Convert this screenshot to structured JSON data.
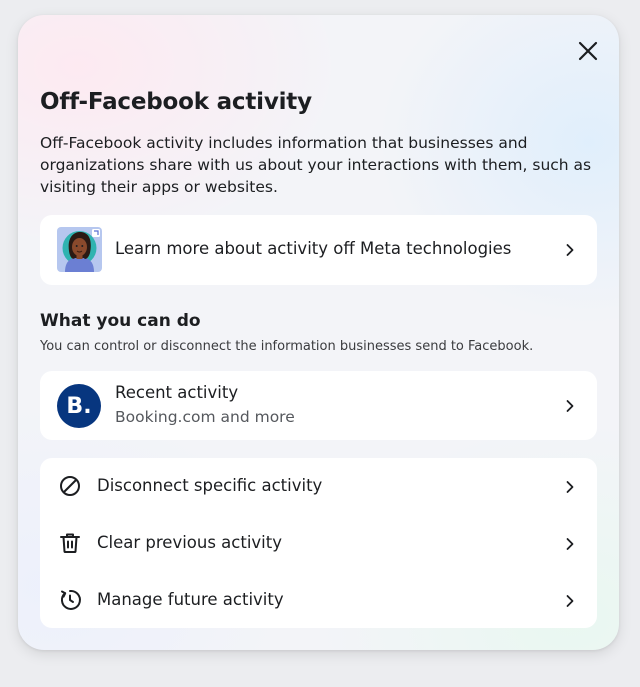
{
  "dialog": {
    "title": "Off-Facebook activity",
    "description": "Off-Facebook activity includes information that businesses and organizations share with us about your interactions with them, such as visiting their apps or websites.",
    "close_icon": "close-icon"
  },
  "learn_more": {
    "label": "Learn more about activity off Meta technologies",
    "image": "avatar-illustration",
    "chevron_icon": "chevron-right-icon"
  },
  "what_you_can_do": {
    "title": "What you can do",
    "subtitle": "You can control or disconnect the information businesses send to Facebook."
  },
  "recent_activity": {
    "logo_text": "B.",
    "logo_color": "#07367f",
    "title": "Recent activity",
    "subtitle": "Booking.com and more",
    "chevron_icon": "chevron-right-icon"
  },
  "actions": [
    {
      "label": "Disconnect specific activity",
      "icon": "block-icon"
    },
    {
      "label": "Clear previous activity",
      "icon": "trash-icon"
    },
    {
      "label": "Manage future activity",
      "icon": "history-icon"
    }
  ]
}
